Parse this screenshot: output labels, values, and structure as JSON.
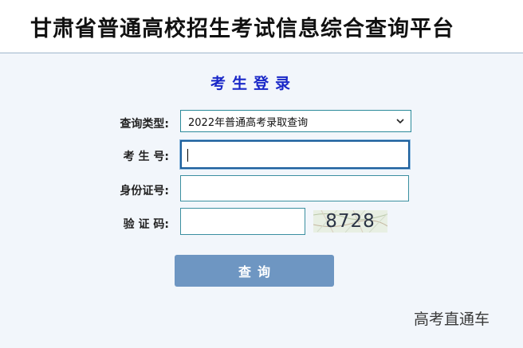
{
  "header": {
    "title": "甘肃省普通高校招生考试信息综合查询平台"
  },
  "login": {
    "title": "考生登录"
  },
  "form": {
    "query_type_label": "查询类型:",
    "query_type_selected": "2022年普通高考录取查询",
    "exam_number_label": "考 生 号:",
    "exam_number_value": "",
    "id_number_label": "身份证号:",
    "id_number_value": "",
    "captcha_label": "验 证 码:",
    "captcha_value": "",
    "captcha_image_text": "8728",
    "submit_label": "查询"
  },
  "watermark": {
    "text": "高考直通车"
  },
  "colors": {
    "title_blue": "#1a28c8",
    "button_blue": "#6e96c2",
    "input_border": "#3b8fa0",
    "focus_border": "#1c5f9c",
    "page_bg": "#f2f6fb"
  },
  "icons": {
    "select_arrow": "chevron-down-icon"
  }
}
